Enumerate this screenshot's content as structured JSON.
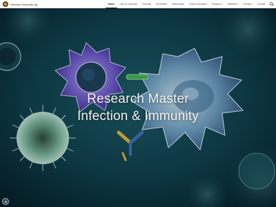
{
  "site": {
    "title": "Infection-Immunity.org"
  },
  "nav": [
    {
      "label": "Home",
      "active": true,
      "dropdown": false
    },
    {
      "label": "How to Lanneras",
      "active": false,
      "dropdown": false
    },
    {
      "label": "Potential",
      "active": false,
      "dropdown": false
    },
    {
      "label": "Enrollment",
      "active": false,
      "dropdown": false
    },
    {
      "label": "Wereschipe",
      "active": false,
      "dropdown": false
    },
    {
      "label": "Online Education",
      "active": false,
      "dropdown": false
    },
    {
      "label": "Program",
      "active": false,
      "dropdown": true
    },
    {
      "label": "Students",
      "active": false,
      "dropdown": true
    },
    {
      "label": "Faculty",
      "active": false,
      "dropdown": true
    },
    {
      "label": "Contact",
      "active": false,
      "dropdown": false
    }
  ],
  "hero": {
    "title_line1": "Research Master",
    "title_line2": "Infection & Immunity"
  },
  "icons": {
    "search": "search-icon",
    "corner": "menu-icon"
  },
  "colors": {
    "nav_bg": "#ffffff",
    "hero_text": "#f2f2f2",
    "hero_bg": "#0b3440"
  }
}
